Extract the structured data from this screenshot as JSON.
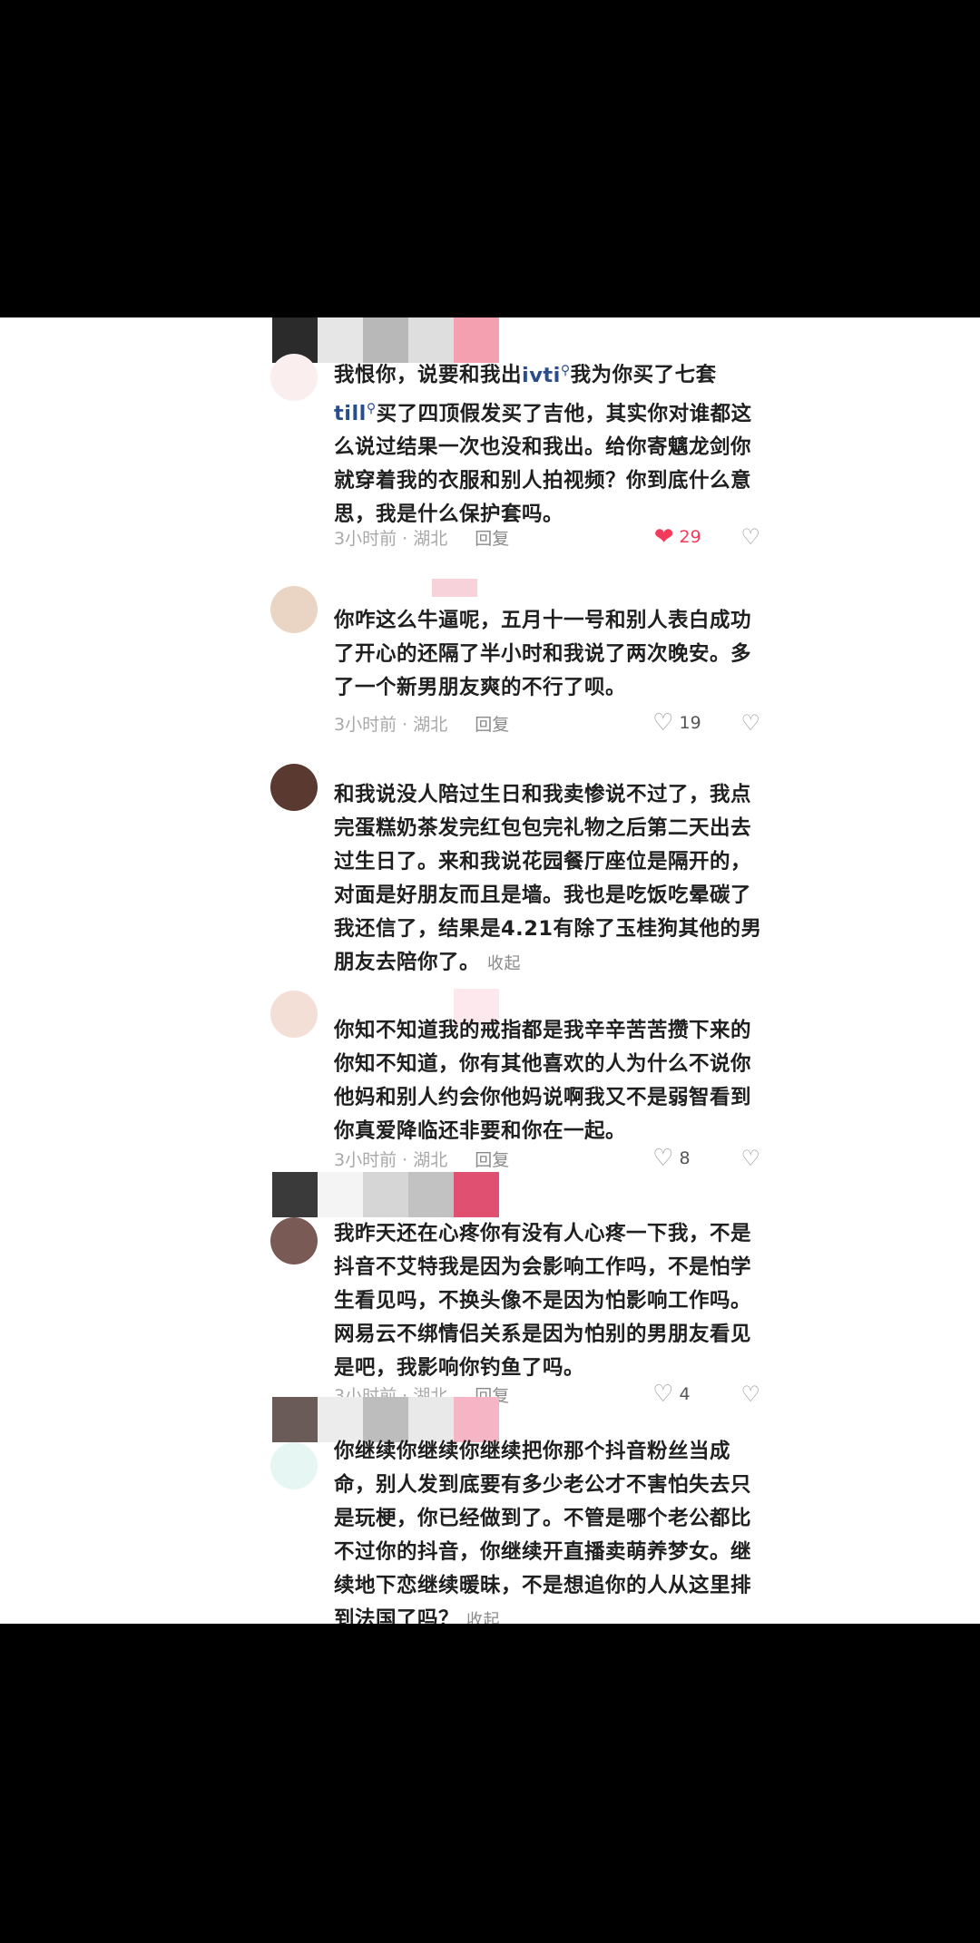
{
  "comments": [
    {
      "text_pre": "我恨你，说要和我出",
      "link1": "ivti",
      "text_mid": "我为你买了七套",
      "link2": "till",
      "text_post": "买了四顶假发买了吉他，其实你对谁都这么说过结果一次也没和我出。给你寄魑龙剑你就穿着我的衣服和别人拍视频？你到底什么意思，我是什么保护套吗。",
      "meta": "3小时前 · 湖北",
      "reply": "回复",
      "likes": "29",
      "liked": true
    },
    {
      "text": "你咋这么牛逼呢，五月十一号和别人表白成功了开心的还隔了半小时和我说了两次晚安。多了一个新男朋友爽的不行了呗。",
      "meta": "3小时前 · 湖北",
      "reply": "回复",
      "likes": "19"
    },
    {
      "text": "和我说没人陪过生日和我卖惨说不过了，我点完蛋糕奶茶发完红包包完礼物之后第二天出去过生日了。来和我说花园餐厅座位是隔开的，对面是好朋友而且是墙。我也是吃饭吃晕碳了我还信了，结果是4.21有除了玉桂狗其他的男朋友去陪你了。",
      "collapse": "收起"
    },
    {
      "text": "你知不知道我的戒指都是我辛辛苦苦攒下来的你知不知道，你有其他喜欢的人为什么不说你他妈和别人约会你他妈说啊我又不是弱智看到你真爱降临还非要和你在一起。",
      "meta": "3小时前 · 湖北",
      "reply": "回复",
      "likes": "8"
    },
    {
      "text": "我昨天还在心疼你有没有人心疼一下我，不是抖音不艾特我是因为会影响工作吗，不是怕学生看见吗，不换头像不是因为怕影响工作吗。网易云不绑情侣关系是因为怕别的男朋友看见是吧，我影响你钓鱼了吗。",
      "meta": "3小时前 · 湖北",
      "reply": "回复",
      "likes": "4"
    },
    {
      "text": "你继续你继续你继续把你那个抖音粉丝当成命，别人发到底要有多少老公才不害怕失去只是玩梗，你已经做到了。不管是哪个老公都比不过你的抖音，你继续开直播卖萌养梦女。继续地下恋继续暖昧，不是想追你的人从这里排到法国了吗？",
      "collapse": "收起"
    }
  ],
  "colors": {
    "like_active": "#f23a5a",
    "link": "#2a4d8c",
    "background_outer": "#000000",
    "background_content": "#ffffff"
  },
  "icons": [
    "heart-icon",
    "heart-outline-icon",
    "broken-heart-icon",
    "search-icon"
  ]
}
